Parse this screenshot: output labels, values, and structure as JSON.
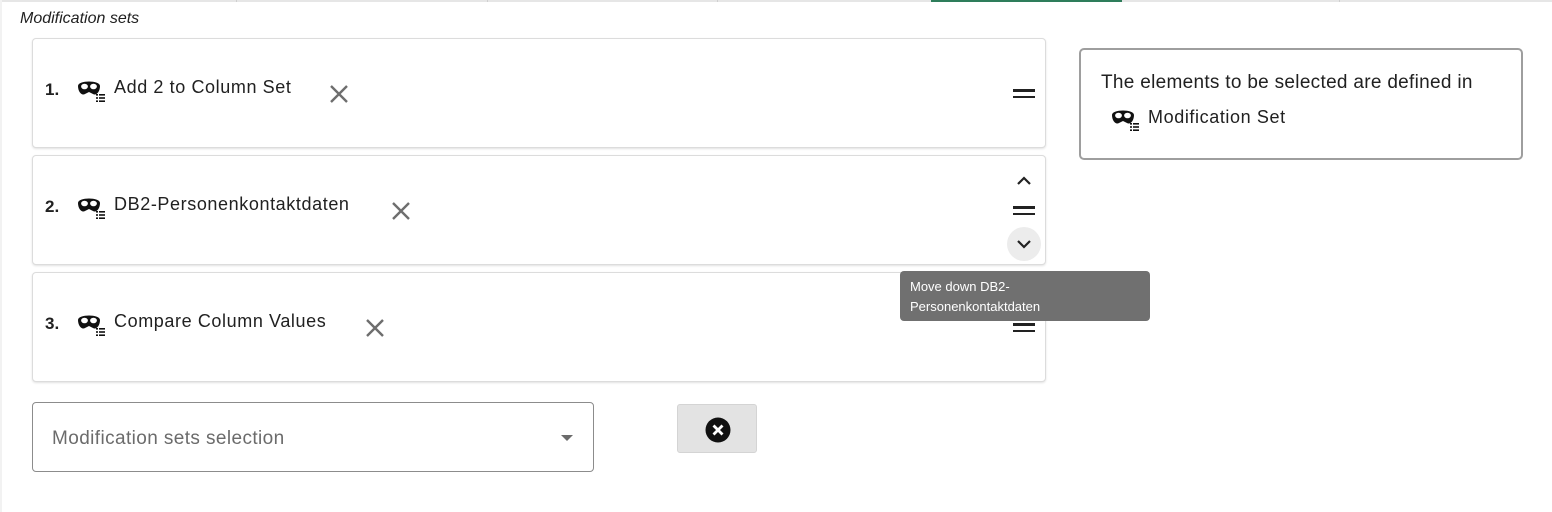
{
  "section": {
    "title": "Modification sets"
  },
  "modification_sets": [
    {
      "index": "1.",
      "label": "Add 2 to Column Set"
    },
    {
      "index": "2.",
      "label": "DB2-Personenkontaktdaten"
    },
    {
      "index": "3.",
      "label": "Compare Column Values"
    }
  ],
  "info_box": {
    "text": "The elements to be selected are defined in",
    "set_name": "Modification Set"
  },
  "tooltip": {
    "line1": "Move down DB2-",
    "line2": "Personenkontaktdaten"
  },
  "selection": {
    "placeholder": "Modification sets selection"
  },
  "icons": {
    "item": "modification-set-mask-icon",
    "remove": "close-icon",
    "drag": "drag-handle-icon",
    "up": "chevron-up-icon",
    "down": "chevron-down-icon",
    "dropdown": "caret-down-icon",
    "clear": "clear-circle-icon"
  },
  "colors": {
    "accent": "#2e7d5b",
    "tooltip_bg": "#707070",
    "clear_button_bg": "#e3e3e3"
  }
}
